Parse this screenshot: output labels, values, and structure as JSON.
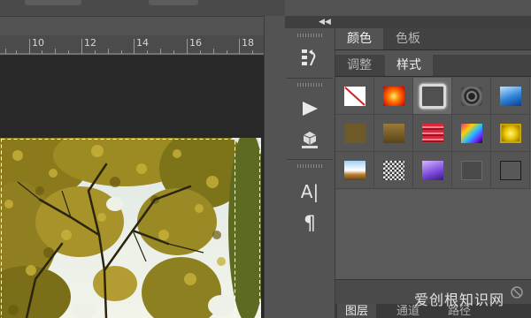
{
  "ruler": {
    "labels": [
      "10",
      "12",
      "14",
      "16",
      "18"
    ]
  },
  "dock": {
    "collapse_icon": "double-chevron-left"
  },
  "tools": [
    {
      "icon": "history-icon"
    },
    {
      "icon": "actions-play-icon"
    },
    {
      "icon": "3d-object-icon"
    },
    {
      "icon": "character-icon",
      "glyph": "A|"
    },
    {
      "icon": "paragraph-icon",
      "glyph": "¶"
    }
  ],
  "panel": {
    "tabs_top": [
      "颜色",
      "色板"
    ],
    "tabs_second": [
      "调整",
      "样式"
    ],
    "active_second": "样式",
    "styles_row1": [
      "none",
      "red-glow",
      "gray-bevel",
      "black-ring",
      "blue-glass"
    ],
    "styles_row2": [
      "olive-matte",
      "bronze",
      "red-stripes",
      "rainbow",
      "gold-bevel"
    ],
    "styles_row3": [
      "sky-gradient",
      "noise",
      "purple-bevel",
      "gray-square",
      "outline-square"
    ],
    "footer_icon": "no-style-icon",
    "tabs_bottom": [
      "图层",
      "通道",
      "路径"
    ]
  },
  "watermark": "爱创根知识网",
  "colors": {
    "panel_bg": "#535353",
    "canvas_bg": "#282828",
    "tab_active": "#535353",
    "tab_inactive": "#424242"
  }
}
